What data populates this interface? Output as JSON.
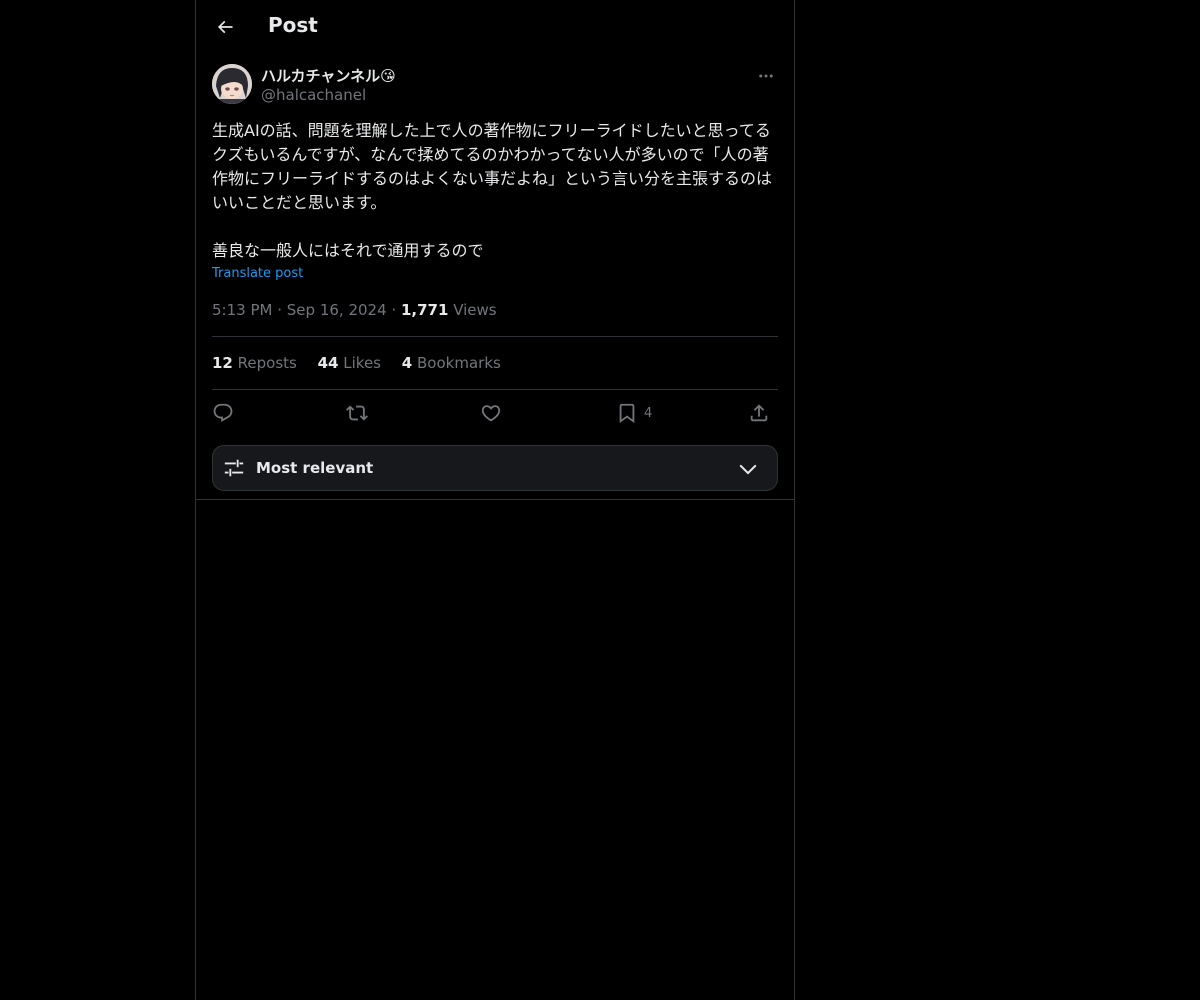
{
  "header": {
    "title": "Post"
  },
  "author": {
    "name": "ハルカチャンネル😘",
    "handle": "@halcachanel"
  },
  "post": {
    "text": "生成AIの話、問題を理解した上で人の著作物にフリーライドしたいと思ってるクズもいるんですが、なんで揉めてるのかわかってない人が多いので「人の著作物にフリーライドするのはよくない事だよね」という言い分を主張するのはいいことだと思います。\n\n善良な一般人にはそれで通用するので",
    "translate_label": "Translate post",
    "time": "5:13 PM",
    "date": "Sep 16, 2024",
    "views_count": "1,771",
    "views_label": "Views"
  },
  "stats": {
    "reposts_count": "12",
    "reposts_label": "Reposts",
    "likes_count": "44",
    "likes_label": "Likes",
    "bookmarks_count": "4",
    "bookmarks_label": "Bookmarks"
  },
  "actions": {
    "reply_icon": "reply-icon",
    "repost_icon": "repost-icon",
    "like_icon": "heart-icon",
    "bookmark_icon": "bookmark-icon",
    "bookmark_count": "4",
    "share_icon": "share-icon"
  },
  "sort": {
    "label": "Most relevant"
  },
  "colors": {
    "background": "#000000",
    "text": "#e7e9ea",
    "muted": "#71767b",
    "link": "#1d9bf0",
    "border": "#2f3336"
  }
}
